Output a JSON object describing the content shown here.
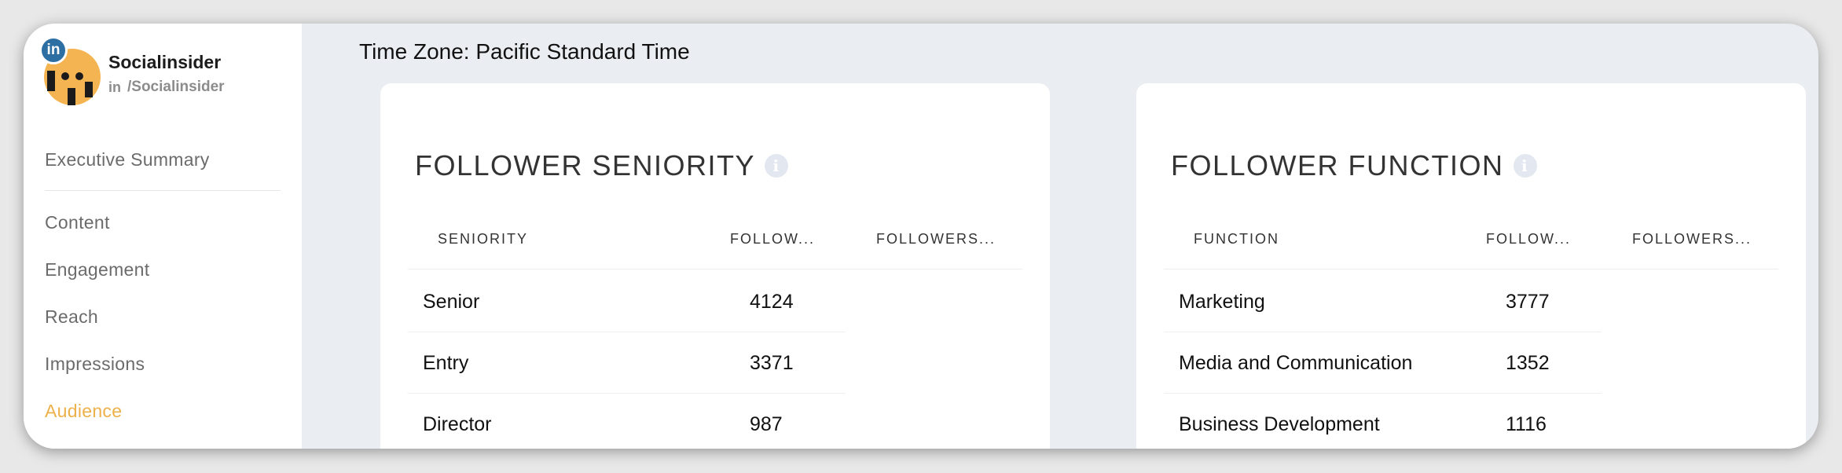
{
  "profile": {
    "badge": "in",
    "name": "Socialinsider",
    "handle_prefix": "in",
    "handle": "/Socialinsider"
  },
  "nav": {
    "items": [
      {
        "label": "Executive Summary"
      },
      {
        "label": "Content"
      },
      {
        "label": "Engagement"
      },
      {
        "label": "Reach"
      },
      {
        "label": "Impressions"
      },
      {
        "label": "Audience",
        "active": true
      }
    ]
  },
  "timezone": "Time Zone: Pacific Standard Time",
  "cards": [
    {
      "title": "FOLLOWER SENIORITY",
      "columns": [
        "SENIORITY",
        "FOLLOW...",
        "FOLLOWERS..."
      ],
      "rows": [
        {
          "label": "Senior",
          "value": "4124"
        },
        {
          "label": "Entry",
          "value": "3371"
        },
        {
          "label": "Director",
          "value": "987"
        }
      ]
    },
    {
      "title": "FOLLOWER FUNCTION",
      "columns": [
        "FUNCTION",
        "FOLLOW...",
        "FOLLOWERS..."
      ],
      "rows": [
        {
          "label": "Marketing",
          "value": "3777"
        },
        {
          "label": "Media and Communication",
          "value": "1352"
        },
        {
          "label": "Business Development",
          "value": "1116"
        }
      ]
    }
  ],
  "colors": {
    "accent": "#eeb049",
    "linkedin": "#2d6ea3",
    "background": "#eaedf2"
  }
}
